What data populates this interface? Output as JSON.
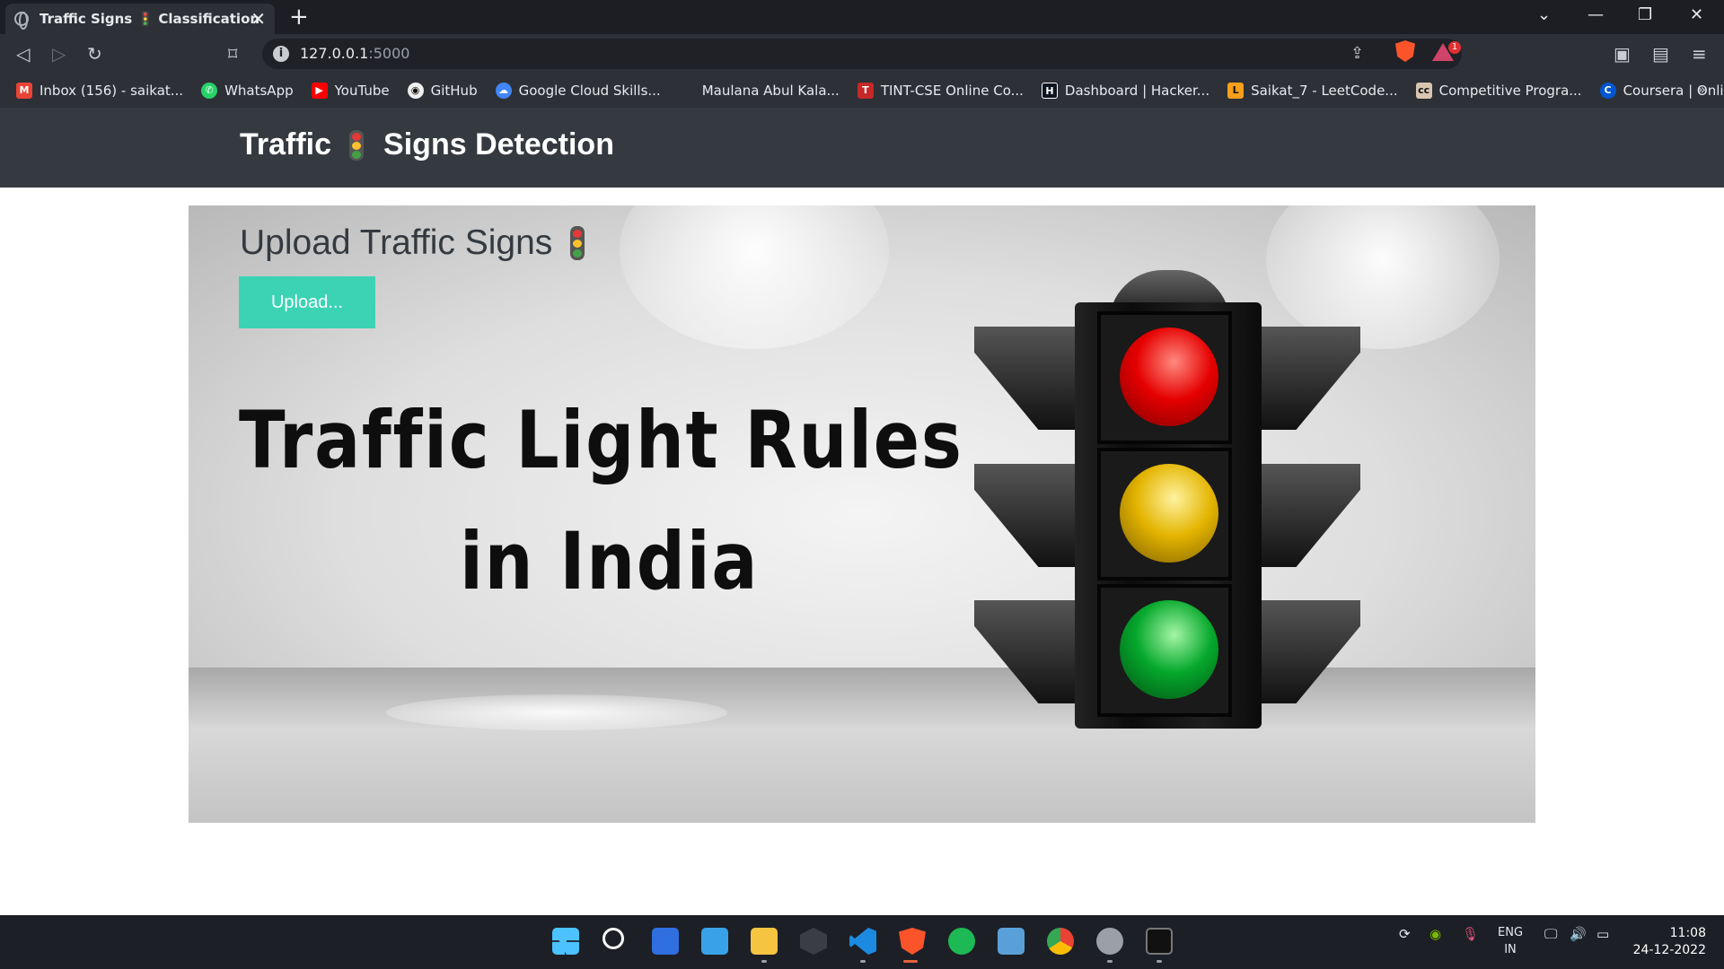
{
  "browser": {
    "tab_title": "Traffic Signs 🚦 Classification",
    "address": "127.0.0.1",
    "port": ":5000",
    "bookmarks": [
      {
        "label": "Inbox (156) - saikat...",
        "icon": "gmail-icon",
        "color": "#ea4335"
      },
      {
        "label": "WhatsApp",
        "icon": "whatsapp-icon",
        "color": "#25d366"
      },
      {
        "label": "YouTube",
        "icon": "youtube-icon",
        "color": "#ff0000"
      },
      {
        "label": "GitHub",
        "icon": "github-icon",
        "color": "#f0f0f0"
      },
      {
        "label": "Google Cloud Skills...",
        "icon": "google-cloud-icon",
        "color": "#4285f4"
      },
      {
        "label": "Maulana Abul Kala...",
        "icon": "blank-page-icon",
        "color": "#2d3036"
      },
      {
        "label": "TINT-CSE Online Co...",
        "icon": "tint-icon",
        "color": "#c62828"
      },
      {
        "label": "Dashboard | Hacker...",
        "icon": "hackerrank-icon",
        "color": "#0e141e"
      },
      {
        "label": "Saikat_7 - LeetCode...",
        "icon": "leetcode-icon",
        "color": "#f89f1b"
      },
      {
        "label": "Competitive Progra...",
        "icon": "codechef-icon",
        "color": "#5b4638"
      },
      {
        "label": "Coursera | Online C...",
        "icon": "coursera-icon",
        "color": "#0056d2"
      }
    ]
  },
  "page": {
    "brand_left": "Traffic",
    "brand_right": "Signs Detection",
    "upload_heading": "Upload Traffic Signs",
    "upload_button": "Upload...",
    "banner_line1": "Traffic Light Rules",
    "banner_line2": "in India",
    "accent_color": "#3cd3b5",
    "header_color": "#343a40"
  },
  "system": {
    "lang_top": "ENG",
    "lang_bottom": "IN",
    "time": "11:08",
    "date": "24-12-2022"
  }
}
